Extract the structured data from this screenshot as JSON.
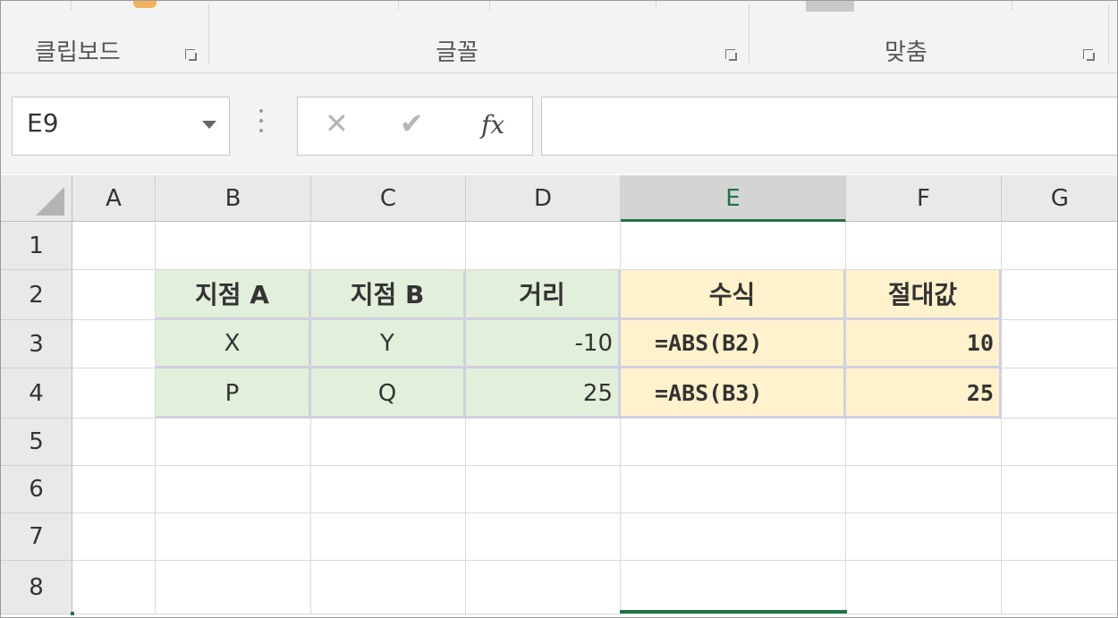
{
  "ribbon": {
    "groups": [
      {
        "label": "클립보드"
      },
      {
        "label": "글꼴"
      },
      {
        "label": "맞춤"
      }
    ]
  },
  "formula_bar": {
    "name_box": "E9",
    "cancel_icon": "✕",
    "enter_icon": "✔",
    "fx_label": "fx",
    "formula": ""
  },
  "columns": [
    "A",
    "B",
    "C",
    "D",
    "E",
    "F",
    "G"
  ],
  "active_column": "E",
  "rows": [
    "1",
    "2",
    "3",
    "4",
    "5",
    "6",
    "7",
    "8"
  ],
  "table": {
    "headers": [
      "지점 A",
      "지점 B",
      "거리",
      "수식",
      "절대값"
    ],
    "data": [
      [
        "X",
        "Y",
        "-10",
        "=ABS(B2)",
        "10"
      ],
      [
        "P",
        "Q",
        "25",
        "=ABS(B3)",
        "25"
      ]
    ]
  },
  "colors": {
    "green_fill": "#e2efda",
    "yellow_fill": "#fff2cc",
    "accent": "#217346"
  }
}
